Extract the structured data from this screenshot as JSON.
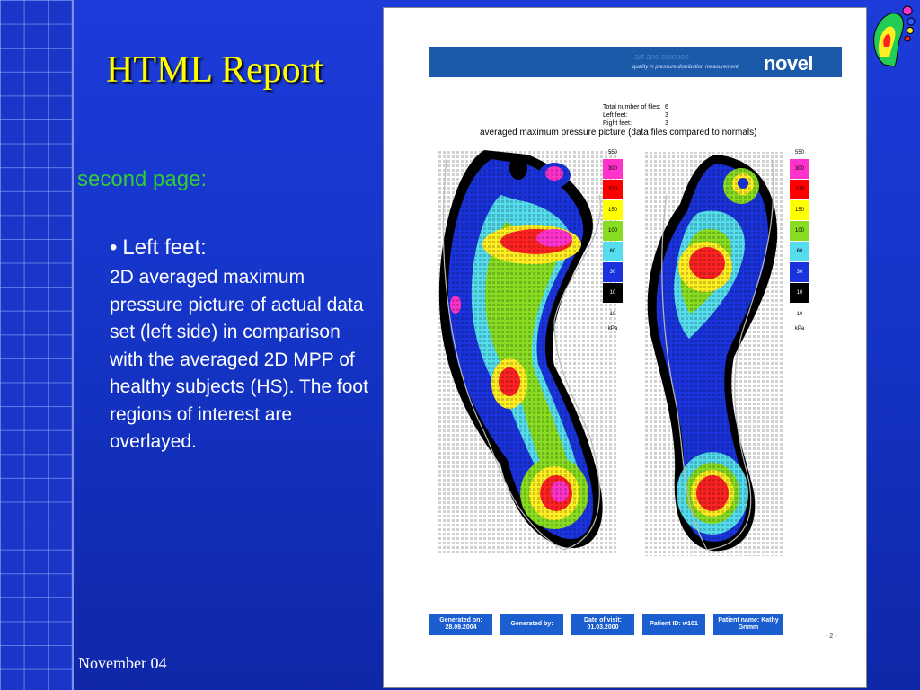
{
  "slide": {
    "title": "HTML Report",
    "subheading": "second page:",
    "bullet": "Left feet:",
    "body": "2D averaged maximum pressure picture of actual data set (left side) in comparison with the averaged 2D MPP of healthy subjects (HS). The foot regions of interest are overlayed.",
    "footer_date": "November 04"
  },
  "report": {
    "banner_tagline": "art and science",
    "banner_subtagline": "quality in pressure distribution measurement",
    "banner_logo": "novel",
    "stats": [
      {
        "label": "Total number of files:",
        "value": "6"
      },
      {
        "label": "Left feet:",
        "value": "3"
      },
      {
        "label": "Right feet:",
        "value": "3"
      }
    ],
    "chart_title": "averaged maximum pressure picture (data files compared to normals)",
    "legend": {
      "top_label": "550",
      "items": [
        "300",
        "220",
        "150",
        "100",
        "60",
        "30",
        "10"
      ],
      "below": "10",
      "unit": "kPa",
      "colors": [
        "#ff33cc",
        "#ff0000",
        "#ffff00",
        "#88dd22",
        "#55ddee",
        "#1a33dd",
        "#000000"
      ]
    },
    "info": [
      {
        "line1": "Generated on:",
        "line2": "28.09.2004"
      },
      {
        "line1": "Generated by:",
        "line2": ""
      },
      {
        "line1": "Date of visit:",
        "line2": "01.03.2000"
      },
      {
        "line1": "Patient ID: w101",
        "line2": ""
      },
      {
        "line1": "Patient name: Kathy",
        "line2": "Grimm"
      }
    ],
    "page_number": "- 2 -"
  }
}
